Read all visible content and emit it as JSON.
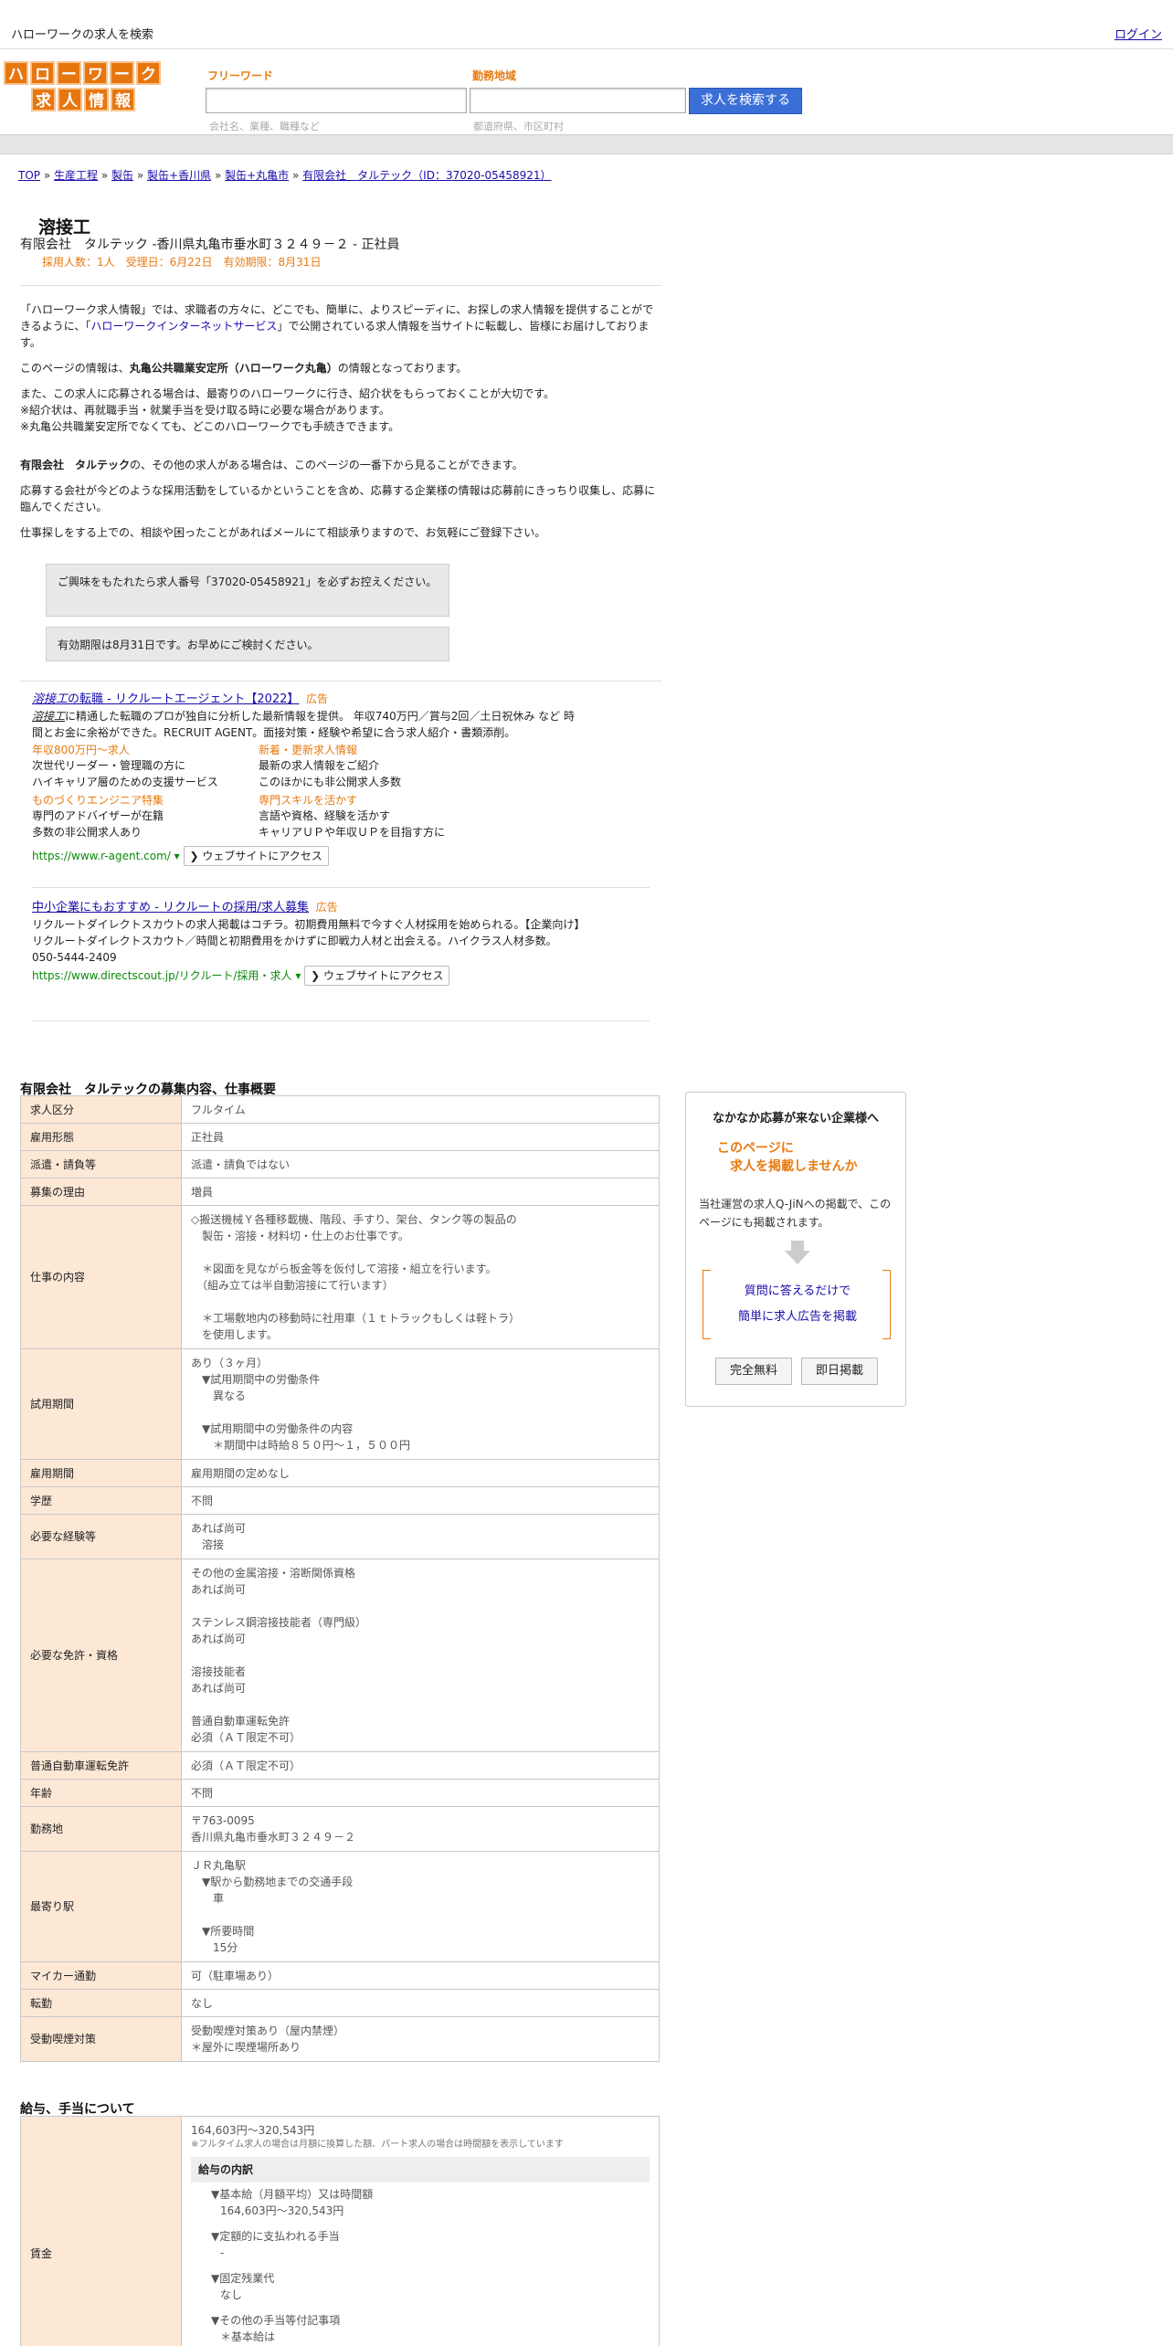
{
  "topbar": {
    "site_name": "ハローワークの求人を検索",
    "login": "ログイン"
  },
  "logo": {
    "line1": [
      "ハ",
      "ロ",
      "ー",
      "ワ",
      "ー",
      "ク"
    ],
    "line2": [
      "求",
      "人",
      "情",
      "報"
    ]
  },
  "search": {
    "freeword_label": "フリーワード",
    "freeword_placeholder": "会社名、業種、職種など",
    "area_label": "勤務地域",
    "area_placeholder": "都道府県、市区町村",
    "button": "求人を検索する"
  },
  "breadcrumb": {
    "items": [
      "TOP",
      "生産工程",
      "製缶",
      "製缶+香川県",
      "製缶+丸亀市",
      "有限会社　タルテック（ID：37020-05458921）"
    ],
    "sep": "»"
  },
  "job": {
    "title": "溶接工",
    "subtitle": "有限会社　タルテック -香川県丸亀市垂水町３２４９－２ - 正社員",
    "meta": "採用人数：1人　受理日：6月22日　有効期限：8月31日"
  },
  "intro": {
    "p1a": "「ハローワーク求人情報」では、求職者の方々に、どこでも、簡単に、よりスピーディに、お探しの求人情報を提供することができるように、「",
    "p1link": "ハローワークインターネットサービス",
    "p1b": "」で公開されている求人情報を当サイトに転載し、皆様にお届けしております。",
    "p2a": "このページの情報は、",
    "p2b": "丸亀公共職業安定所（ハローワーク丸亀）",
    "p2c": "の情報となっております。",
    "p3": "また、この求人に応募される場合は、最寄りのハローワークに行き、紹介状をもらっておくことが大切です。\n※紹介状は、再就職手当・就業手当を受け取る時に必要な場合があります。\n※丸亀公共職業安定所でなくても、どこのハローワークでも手続きできます。",
    "p4a": "有限会社　タルテック",
    "p4b": "の、その他の求人がある場合は、このページの一番下から見ることができます。",
    "p5": "応募する会社が今どのような採用活動をしているかということを含め、応募する企業様の情報は応募前にきっちり収集し、応募に臨んでください。",
    "p6": "仕事探しをする上での、相談や困ったことがあればメールにて相談承りますので、お気軽にご登録下さい。"
  },
  "notices": [
    "ご興味をもたれたら求人番号「37020-05458921」を必ずお控えください。",
    "有効期限は8月31日です。お早めにご検討ください。"
  ],
  "ads": [
    {
      "title_em": "溶接工",
      "title": "の転職 - リクルートエージェント【2022】",
      "tag": "広告",
      "body_em": "溶接工",
      "body": "に精通した転職のプロが独自に分析した最新情報を提供。 年収740万円／賞与2回／土日祝休み など 時間とお金に余裕ができた。RECRUIT AGENT。面接対策・経験や希望に合う求人紹介・書類添削。",
      "links": [
        {
          "head": "年収800万円～求人",
          "l1": "次世代リーダー・管理職の方に",
          "l2": "ハイキャリア層のための支援サービス"
        },
        {
          "head": "新着・更新求人情報",
          "l1": "最新の求人情報をご紹介",
          "l2": "このほかにも非公開求人多数"
        },
        {
          "head": "ものづくりエンジニア特集",
          "l1": "専門のアドバイザーが在籍",
          "l2": "多数の非公開求人あり"
        },
        {
          "head": "専門スキルを活かす",
          "l1": "言語や資格、経験を活かす",
          "l2": "キャリアＵＰや年収ＵＰを目指す方に"
        }
      ],
      "url": "https://www.r-agent.com/",
      "button": "ウェブサイトにアクセス"
    },
    {
      "title": "中小企業にもおすすめ - リクルートの採用/求人募集",
      "tag": "広告",
      "body": "リクルートダイレクトスカウトの求人掲載はコチラ。初期費用無料で今すぐ人材採用を始められる。【企業向け】リクルートダイレクトスカウト／時間と初期費用をかけずに即戦力人材と出会える。ハイクラス人材多数。",
      "phone": "050-5444-2409",
      "url": "https://www.directscout.jp/リクルート/採用・求人",
      "button": "ウェブサイトにアクセス"
    }
  ],
  "overview": {
    "heading": "有限会社　タルテックの募集内容、仕事概要",
    "rows": [
      [
        "求人区分",
        "フルタイム"
      ],
      [
        "雇用形態",
        "正社員"
      ],
      [
        "派遣・請負等",
        "派遣・請負ではない"
      ],
      [
        "募集の理由",
        "増員"
      ],
      [
        "仕事の内容",
        "◇搬送機械Ｙ各種移載機、階段、手すり、架台、タンク等の製品の\n　製缶・溶接・材料切・仕上のお仕事です。\n\n　＊図面を見ながら板金等を仮付して溶接・組立を行います。\n　（組み立ては半自動溶接にて行います）\n\n　＊工場敷地内の移動時に社用車（１ｔトラックもしくは軽トラ）\n　を使用します。"
      ],
      [
        "試用期間",
        "あり（３ヶ月）\n　▼試用期間中の労働条件\n　　異なる\n\n　▼試用期間中の労働条件の内容\n　　＊期間中は時給８５０円～１，５００円"
      ],
      [
        "雇用期間",
        "雇用期間の定めなし"
      ],
      [
        "学歴",
        "不問"
      ],
      [
        "必要な経験等",
        "あれば尚可\n　溶接"
      ],
      [
        "必要な免許・資格",
        "その他の金属溶接・溶断関係資格\nあれば尚可\n\nステンレス鋼溶接技能者（専門級）\nあれば尚可\n\n溶接技能者\nあれば尚可\n\n普通自動車運転免許\n必須（ＡＴ限定不可）"
      ],
      [
        "普通自動車運転免許",
        "必須（ＡＴ限定不可）"
      ],
      [
        "年齢",
        "不問"
      ],
      [
        "勤務地",
        "〒763-0095\n香川県丸亀市垂水町３２４９－２"
      ],
      [
        "最寄り駅",
        "ＪＲ丸亀駅\n　▼駅から勤務地までの交通手段\n　　車\n\n　▼所要時間\n　　15分"
      ],
      [
        "マイカー通勤",
        "可（駐車場あり）"
      ],
      [
        "転勤",
        "なし"
      ],
      [
        "受動喫煙対策",
        "受動喫煙対策あり（屋内禁煙）\n＊屋外に喫煙場所あり"
      ]
    ]
  },
  "wage": {
    "heading": "給与、手当について",
    "label": "賃金",
    "range": "164,603円〜320,543円",
    "note": "※フルタイム求人の場合は月額に換算した額、パート求人の場合は時間額を表示しています",
    "breakdown_head": "給与の内訳",
    "items": [
      [
        "▼基本給（月額平均）又は時間額",
        "164,603円〜320,543円"
      ],
      [
        "▼定額的に支払われる手当",
        "-"
      ],
      [
        "▼固定残業代",
        "なし"
      ],
      [
        "▼その他の手当等付記事項",
        "＊基本給は"
      ]
    ]
  },
  "sidebar": {
    "title": "なかなか応募が来ない企業様へ",
    "catch1": "このページに",
    "catch2": "求人を掲載しませんか",
    "desc": "当社運営の求人Q-JiNへの掲載で、このページにも掲載されます。",
    "link1": "質問に答えるだけで",
    "link2": "簡単に求人広告を掲載",
    "btn1": "完全無料",
    "btn2": "即日掲載"
  },
  "colors": {
    "accent": "#e87a10",
    "button": "#3b6fd8",
    "header_cell": "#fde8d6",
    "link": "#1a0dab"
  }
}
